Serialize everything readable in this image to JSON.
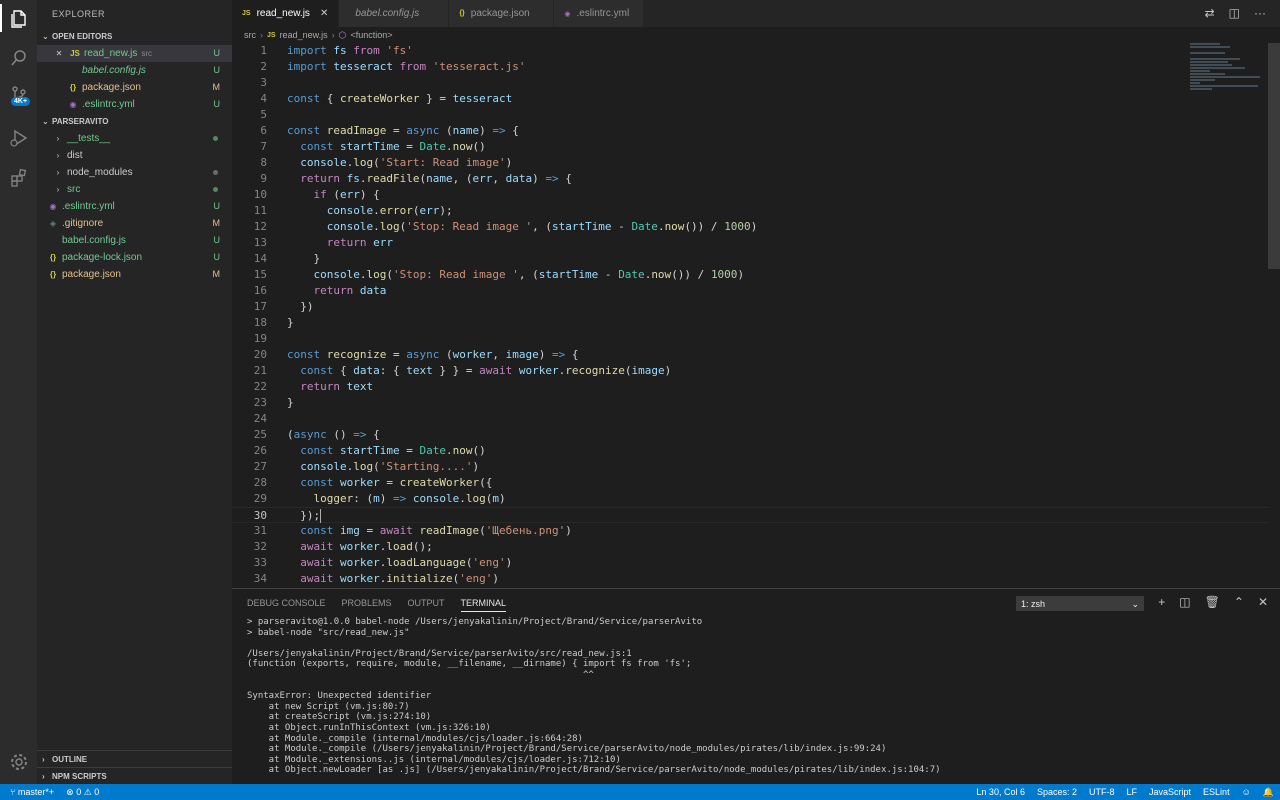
{
  "activity": {
    "badge": "4K+"
  },
  "sidebar": {
    "title": "EXPLORER",
    "open_editors_title": "OPEN EDITORS",
    "open_editors": [
      {
        "icon": "JS",
        "name": "read_new.js",
        "desc": "src",
        "badge": "U",
        "close": "✕",
        "selected": true
      },
      {
        "icon": "",
        "name": "babel.config.js",
        "desc": "",
        "badge": "U",
        "italic": true
      },
      {
        "icon": "{}",
        "name": "package.json",
        "desc": "",
        "badge": "M"
      },
      {
        "icon": "◉",
        "name": ".eslintrc.yml",
        "desc": "",
        "badge": "U"
      }
    ],
    "project_title": "PARSERAVITO",
    "tree": [
      {
        "chev": "›",
        "name": "__tests__",
        "color": "green",
        "marker": "dot"
      },
      {
        "chev": "›",
        "name": "dist",
        "color": "plain",
        "marker": ""
      },
      {
        "chev": "›",
        "name": "node_modules",
        "color": "plain",
        "marker": "dot-grey"
      },
      {
        "chev": "›",
        "name": "src",
        "color": "green",
        "marker": "dot"
      },
      {
        "chev": "",
        "icon": "◉",
        "name": ".eslintrc.yml",
        "color": "green",
        "marker": "U"
      },
      {
        "chev": "",
        "icon": "◈",
        "name": ".gitignore",
        "color": "yellow",
        "marker": "M"
      },
      {
        "chev": "",
        "icon": "",
        "name": "babel.config.js",
        "color": "green",
        "marker": "U"
      },
      {
        "chev": "",
        "icon": "{}",
        "name": "package-lock.json",
        "color": "green",
        "marker": "U"
      },
      {
        "chev": "",
        "icon": "{}",
        "name": "package.json",
        "color": "yellow",
        "marker": "M"
      }
    ],
    "outline_title": "OUTLINE",
    "npm_title": "NPM SCRIPTS"
  },
  "tabs": [
    {
      "icon": "JS",
      "label": "read_new.js",
      "active": true,
      "close": "✕"
    },
    {
      "icon": "",
      "label": "babel.config.js",
      "active": false
    },
    {
      "icon": "{}",
      "label": "package.json",
      "active": false
    },
    {
      "icon": "◉",
      "label": ".eslintrc.yml",
      "active": false
    }
  ],
  "breadcrumb": {
    "folder": "src",
    "file_icon": "JS",
    "file": "read_new.js",
    "symbol": "<function>"
  },
  "editor": {
    "current_line": 30,
    "lines": [
      [
        [
          "kw",
          "import"
        ],
        [
          "pun",
          " "
        ],
        [
          "var",
          "fs"
        ],
        [
          "pun",
          " "
        ],
        [
          "ctl",
          "from"
        ],
        [
          "pun",
          " "
        ],
        [
          "str",
          "'fs'"
        ]
      ],
      [
        [
          "kw",
          "import"
        ],
        [
          "pun",
          " "
        ],
        [
          "var",
          "tesseract"
        ],
        [
          "pun",
          " "
        ],
        [
          "ctl",
          "from"
        ],
        [
          "pun",
          " "
        ],
        [
          "str",
          "'tesseract.js'"
        ]
      ],
      [],
      [
        [
          "kw",
          "const"
        ],
        [
          "pun",
          " { "
        ],
        [
          "fn",
          "createWorker"
        ],
        [
          "pun",
          " } = "
        ],
        [
          "var",
          "tesseract"
        ]
      ],
      [],
      [
        [
          "kw",
          "const"
        ],
        [
          "pun",
          " "
        ],
        [
          "fn",
          "readImage"
        ],
        [
          "pun",
          " = "
        ],
        [
          "kw",
          "async"
        ],
        [
          "pun",
          " ("
        ],
        [
          "var",
          "name"
        ],
        [
          "pun",
          ") "
        ],
        [
          "kw",
          "=>"
        ],
        [
          "pun",
          " {"
        ]
      ],
      [
        [
          "pun",
          "  "
        ],
        [
          "kw",
          "const"
        ],
        [
          "pun",
          " "
        ],
        [
          "var",
          "startTime"
        ],
        [
          "pun",
          " = "
        ],
        [
          "cls",
          "Date"
        ],
        [
          "pun",
          "."
        ],
        [
          "fn",
          "now"
        ],
        [
          "pun",
          "()"
        ]
      ],
      [
        [
          "pun",
          "  "
        ],
        [
          "var",
          "console"
        ],
        [
          "pun",
          "."
        ],
        [
          "fn",
          "log"
        ],
        [
          "pun",
          "("
        ],
        [
          "str",
          "'Start: Read image'"
        ],
        [
          "pun",
          ")"
        ]
      ],
      [
        [
          "pun",
          "  "
        ],
        [
          "ctl",
          "return"
        ],
        [
          "pun",
          " "
        ],
        [
          "var",
          "fs"
        ],
        [
          "pun",
          "."
        ],
        [
          "fn",
          "readFile"
        ],
        [
          "pun",
          "("
        ],
        [
          "var",
          "name"
        ],
        [
          "pun",
          ", ("
        ],
        [
          "var",
          "err"
        ],
        [
          "pun",
          ", "
        ],
        [
          "var",
          "data"
        ],
        [
          "pun",
          ") "
        ],
        [
          "kw",
          "=>"
        ],
        [
          "pun",
          " {"
        ]
      ],
      [
        [
          "pun",
          "    "
        ],
        [
          "ctl",
          "if"
        ],
        [
          "pun",
          " ("
        ],
        [
          "var",
          "err"
        ],
        [
          "pun",
          ") {"
        ]
      ],
      [
        [
          "pun",
          "      "
        ],
        [
          "var",
          "console"
        ],
        [
          "pun",
          "."
        ],
        [
          "fn",
          "error"
        ],
        [
          "pun",
          "("
        ],
        [
          "var",
          "err"
        ],
        [
          "pun",
          ");"
        ]
      ],
      [
        [
          "pun",
          "      "
        ],
        [
          "var",
          "console"
        ],
        [
          "pun",
          "."
        ],
        [
          "fn",
          "log"
        ],
        [
          "pun",
          "("
        ],
        [
          "str",
          "'Stop: Read image '"
        ],
        [
          "pun",
          ", ("
        ],
        [
          "var",
          "startTime"
        ],
        [
          "pun",
          " - "
        ],
        [
          "cls",
          "Date"
        ],
        [
          "pun",
          "."
        ],
        [
          "fn",
          "now"
        ],
        [
          "pun",
          "()) / "
        ],
        [
          "num",
          "1000"
        ],
        [
          "pun",
          ")"
        ]
      ],
      [
        [
          "pun",
          "      "
        ],
        [
          "ctl",
          "return"
        ],
        [
          "pun",
          " "
        ],
        [
          "var",
          "err"
        ]
      ],
      [
        [
          "pun",
          "    }"
        ]
      ],
      [
        [
          "pun",
          "    "
        ],
        [
          "var",
          "console"
        ],
        [
          "pun",
          "."
        ],
        [
          "fn",
          "log"
        ],
        [
          "pun",
          "("
        ],
        [
          "str",
          "'Stop: Read image '"
        ],
        [
          "pun",
          ", ("
        ],
        [
          "var",
          "startTime"
        ],
        [
          "pun",
          " - "
        ],
        [
          "cls",
          "Date"
        ],
        [
          "pun",
          "."
        ],
        [
          "fn",
          "now"
        ],
        [
          "pun",
          "()) / "
        ],
        [
          "num",
          "1000"
        ],
        [
          "pun",
          ")"
        ]
      ],
      [
        [
          "pun",
          "    "
        ],
        [
          "ctl",
          "return"
        ],
        [
          "pun",
          " "
        ],
        [
          "var",
          "data"
        ]
      ],
      [
        [
          "pun",
          "  })"
        ]
      ],
      [
        [
          "pun",
          "}"
        ]
      ],
      [],
      [
        [
          "kw",
          "const"
        ],
        [
          "pun",
          " "
        ],
        [
          "fn",
          "recognize"
        ],
        [
          "pun",
          " = "
        ],
        [
          "kw",
          "async"
        ],
        [
          "pun",
          " ("
        ],
        [
          "var",
          "worker"
        ],
        [
          "pun",
          ", "
        ],
        [
          "var",
          "image"
        ],
        [
          "pun",
          ") "
        ],
        [
          "kw",
          "=>"
        ],
        [
          "pun",
          " {"
        ]
      ],
      [
        [
          "pun",
          "  "
        ],
        [
          "kw",
          "const"
        ],
        [
          "pun",
          " { "
        ],
        [
          "var",
          "data"
        ],
        [
          "pun",
          ": { "
        ],
        [
          "var",
          "text"
        ],
        [
          "pun",
          " } } = "
        ],
        [
          "ctl",
          "await"
        ],
        [
          "pun",
          " "
        ],
        [
          "var",
          "worker"
        ],
        [
          "pun",
          "."
        ],
        [
          "fn",
          "recognize"
        ],
        [
          "pun",
          "("
        ],
        [
          "var",
          "image"
        ],
        [
          "pun",
          ")"
        ]
      ],
      [
        [
          "pun",
          "  "
        ],
        [
          "ctl",
          "return"
        ],
        [
          "pun",
          " "
        ],
        [
          "var",
          "text"
        ]
      ],
      [
        [
          "pun",
          "}"
        ]
      ],
      [],
      [
        [
          "pun",
          "("
        ],
        [
          "kw",
          "async"
        ],
        [
          "pun",
          " () "
        ],
        [
          "kw",
          "=>"
        ],
        [
          "pun",
          " {"
        ]
      ],
      [
        [
          "pun",
          "  "
        ],
        [
          "kw",
          "const"
        ],
        [
          "pun",
          " "
        ],
        [
          "var",
          "startTime"
        ],
        [
          "pun",
          " = "
        ],
        [
          "cls",
          "Date"
        ],
        [
          "pun",
          "."
        ],
        [
          "fn",
          "now"
        ],
        [
          "pun",
          "()"
        ]
      ],
      [
        [
          "pun",
          "  "
        ],
        [
          "var",
          "console"
        ],
        [
          "pun",
          "."
        ],
        [
          "fn",
          "log"
        ],
        [
          "pun",
          "("
        ],
        [
          "str",
          "'Starting....'"
        ],
        [
          "pun",
          ")"
        ]
      ],
      [
        [
          "pun",
          "  "
        ],
        [
          "kw",
          "const"
        ],
        [
          "pun",
          " "
        ],
        [
          "var",
          "worker"
        ],
        [
          "pun",
          " = "
        ],
        [
          "fn",
          "createWorker"
        ],
        [
          "pun",
          "({"
        ]
      ],
      [
        [
          "pun",
          "    "
        ],
        [
          "fn",
          "logger"
        ],
        [
          "pun",
          ": ("
        ],
        [
          "var",
          "m"
        ],
        [
          "pun",
          ") "
        ],
        [
          "kw",
          "=>"
        ],
        [
          "pun",
          " "
        ],
        [
          "var",
          "console"
        ],
        [
          "pun",
          "."
        ],
        [
          "fn",
          "log"
        ],
        [
          "pun",
          "("
        ],
        [
          "var",
          "m"
        ],
        [
          "pun",
          ")"
        ]
      ],
      [
        [
          "pun",
          "  });"
        ]
      ],
      [
        [
          "pun",
          "  "
        ],
        [
          "kw",
          "const"
        ],
        [
          "pun",
          " "
        ],
        [
          "var",
          "img"
        ],
        [
          "pun",
          " = "
        ],
        [
          "ctl",
          "await"
        ],
        [
          "pun",
          " "
        ],
        [
          "fn",
          "readImage"
        ],
        [
          "pun",
          "("
        ],
        [
          "str",
          "'Щебень.png'"
        ],
        [
          "pun",
          ")"
        ]
      ],
      [
        [
          "pun",
          "  "
        ],
        [
          "ctl",
          "await"
        ],
        [
          "pun",
          " "
        ],
        [
          "var",
          "worker"
        ],
        [
          "pun",
          "."
        ],
        [
          "fn",
          "load"
        ],
        [
          "pun",
          "();"
        ]
      ],
      [
        [
          "pun",
          "  "
        ],
        [
          "ctl",
          "await"
        ],
        [
          "pun",
          " "
        ],
        [
          "var",
          "worker"
        ],
        [
          "pun",
          "."
        ],
        [
          "fn",
          "loadLanguage"
        ],
        [
          "pun",
          "("
        ],
        [
          "str",
          "'eng'"
        ],
        [
          "pun",
          ")"
        ]
      ],
      [
        [
          "pun",
          "  "
        ],
        [
          "ctl",
          "await"
        ],
        [
          "pun",
          " "
        ],
        [
          "var",
          "worker"
        ],
        [
          "pun",
          "."
        ],
        [
          "fn",
          "initialize"
        ],
        [
          "pun",
          "("
        ],
        [
          "str",
          "'eng'"
        ],
        [
          "pun",
          ")"
        ]
      ]
    ]
  },
  "panel": {
    "tabs": [
      "DEBUG CONSOLE",
      "PROBLEMS",
      "OUTPUT",
      "TERMINAL"
    ],
    "active_tab": "TERMINAL",
    "terminal_select": "1: zsh",
    "terminal_lines": [
      "> parseravito@1.0.0 babel-node /Users/jenyakalinin/Project/Brand/Service/parserAvito",
      "> babel-node \"src/read_new.js\"",
      "",
      "/Users/jenyakalinin/Project/Brand/Service/parserAvito/src/read_new.js:1",
      "(function (exports, require, module, __filename, __dirname) { import fs from 'fs';",
      "                                                              ^^",
      "",
      "SyntaxError: Unexpected identifier",
      "    at new Script (vm.js:80:7)",
      "    at createScript (vm.js:274:10)",
      "    at Object.runInThisContext (vm.js:326:10)",
      "    at Module._compile (internal/modules/cjs/loader.js:664:28)",
      "    at Module._compile (/Users/jenyakalinin/Project/Brand/Service/parserAvito/node_modules/pirates/lib/index.js:99:24)",
      "    at Module._extensions..js (internal/modules/cjs/loader.js:712:10)",
      "    at Object.newLoader [as .js] (/Users/jenyakalinin/Project/Brand/Service/parserAvito/node_modules/pirates/lib/index.js:104:7)"
    ]
  },
  "status": {
    "branch": "master*+",
    "problems": "⊗ 0 ⚠ 0",
    "position": "Ln 30, Col 6",
    "spaces": "Spaces: 2",
    "encoding": "UTF-8",
    "eol": "LF",
    "language": "JavaScript",
    "linter": "ESLint"
  },
  "colors": {
    "accent": "#007acc",
    "sidebar": "#252526",
    "editor": "#1e1e1e"
  }
}
